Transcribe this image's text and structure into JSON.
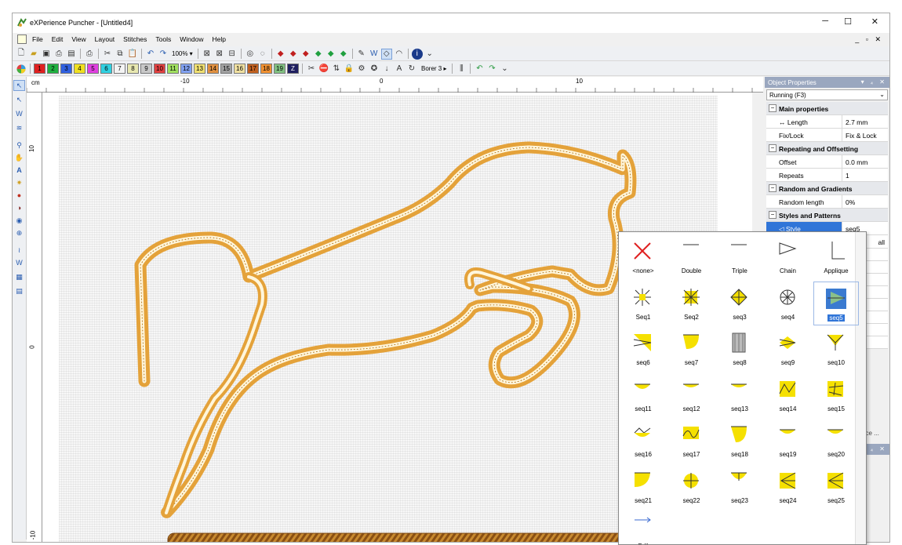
{
  "window": {
    "title": "eXPerience Puncher - [Untitled4]",
    "minimize": "─",
    "maximize": "☐",
    "close": "✕"
  },
  "menu": [
    "File",
    "Edit",
    "View",
    "Layout",
    "Stitches",
    "Tools",
    "Window",
    "Help"
  ],
  "mdi_controls": "_ ▫ ✕",
  "toolbar1": {
    "zoom": "100% ▾"
  },
  "color_palette": {
    "buttons": [
      {
        "n": "1",
        "c": "#e02020"
      },
      {
        "n": "2",
        "c": "#20b040"
      },
      {
        "n": "3",
        "c": "#3060e0"
      },
      {
        "n": "4",
        "c": "#f0e020"
      },
      {
        "n": "5",
        "c": "#e040e0"
      },
      {
        "n": "6",
        "c": "#30d0e0"
      },
      {
        "n": "7",
        "c": "#f4f4f4"
      },
      {
        "n": "8",
        "c": "#e8e8b0"
      },
      {
        "n": "9",
        "c": "#c8c8c8"
      },
      {
        "n": "10",
        "c": "#e04040"
      },
      {
        "n": "11",
        "c": "#a0e060"
      },
      {
        "n": "12",
        "c": "#80a0f0"
      },
      {
        "n": "13",
        "c": "#f0e070"
      },
      {
        "n": "14",
        "c": "#e09040"
      },
      {
        "n": "15",
        "c": "#a0a0a0"
      },
      {
        "n": "16",
        "c": "#f0e0a0"
      },
      {
        "n": "17",
        "c": "#c06020"
      },
      {
        "n": "18",
        "c": "#f09030"
      },
      {
        "n": "19",
        "c": "#80c080"
      },
      {
        "n": "Z",
        "c": "#202060"
      }
    ],
    "borer": "Borer 3 ▸"
  },
  "rulers": {
    "unit": "cm",
    "h_labels": [
      "-10",
      "0",
      "10"
    ],
    "v_labels": [
      "10",
      "0",
      "-10"
    ]
  },
  "panel": {
    "title": "Object Properties",
    "title_controls": "▾ ₄ ✕",
    "stitch_type": "Running (F3)",
    "sections": [
      {
        "title": "Main properties",
        "rows": [
          {
            "k": "Length",
            "v": "2.7 mm"
          },
          {
            "k": "Fix/Lock",
            "v": "Fix & Lock"
          }
        ]
      },
      {
        "title": "Repeating and Offsetting",
        "rows": [
          {
            "k": "Offset",
            "v": "0.0 mm"
          },
          {
            "k": "Repeats",
            "v": "1"
          }
        ]
      },
      {
        "title": "Random and Gradients",
        "rows": [
          {
            "k": "Random length",
            "v": "0%"
          }
        ]
      },
      {
        "title": "Styles and Patterns",
        "rows": [
          {
            "k": "Style",
            "v": "seq5"
          }
        ]
      }
    ],
    "fragment_all": "all",
    "fragment_nce": "nce ...",
    "bottom_controls": "▾ ₄ ✕"
  },
  "style_popup": {
    "items": [
      "<none>",
      "Double",
      "Triple",
      "Chain",
      "Applique",
      "Seq1",
      "Seq2",
      "seq3",
      "seq4",
      "seq5",
      "seq6",
      "seq7",
      "seq8",
      "seq9",
      "seq10",
      "seq11",
      "seq12",
      "seq13",
      "seq14",
      "seq15",
      "seq16",
      "seq17",
      "seq18",
      "seq19",
      "seq20",
      "seq21",
      "seq22",
      "seq23",
      "seq24",
      "seq25",
      "Frill"
    ],
    "selected": "seq5"
  },
  "colors": {
    "yellow": "#f5e000",
    "selection": "#3075d8",
    "stitch_gold": "#e0a830",
    "stitch_brown": "#9a5a1a"
  }
}
